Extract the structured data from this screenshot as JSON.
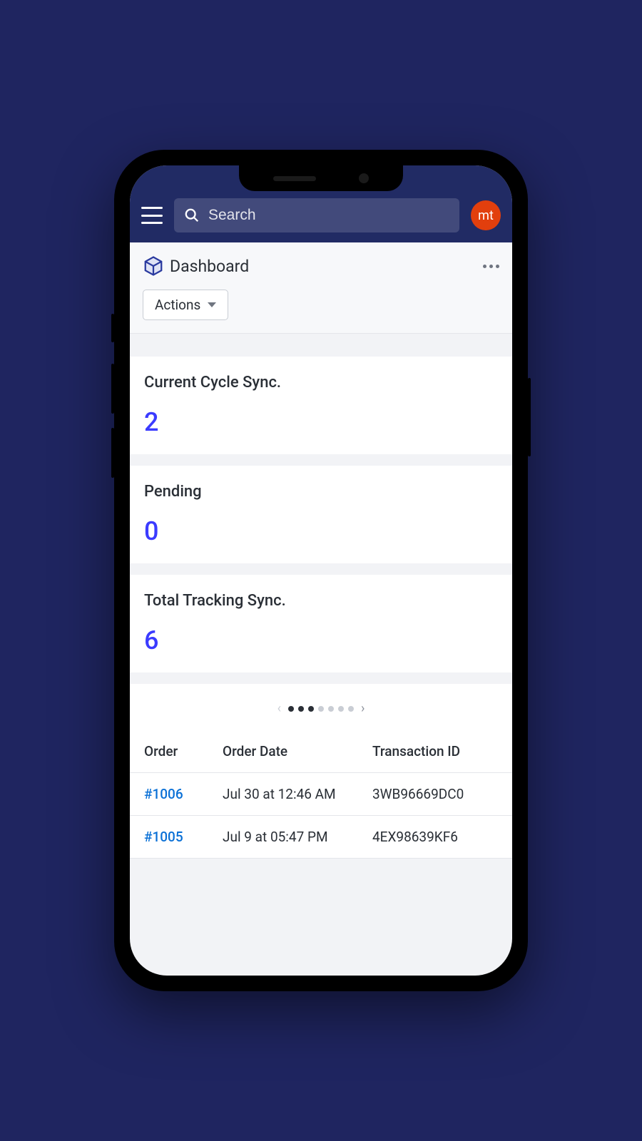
{
  "header": {
    "search_placeholder": "Search",
    "avatar_text": "mt"
  },
  "page": {
    "title": "Dashboard",
    "actions_label": "Actions"
  },
  "cards": [
    {
      "label": "Current Cycle Sync.",
      "value": "2"
    },
    {
      "label": "Pending",
      "value": "0"
    },
    {
      "label": "Total Tracking Sync.",
      "value": "6"
    }
  ],
  "pager": {
    "active_count": 3,
    "total": 7
  },
  "table": {
    "headers": {
      "order": "Order",
      "date": "Order Date",
      "txn": "Transaction ID"
    },
    "rows": [
      {
        "order": "#1006",
        "date": "Jul 30 at 12:46 AM",
        "txn": "3WB96669DC0"
      },
      {
        "order": "#1005",
        "date": "Jul 9 at 05:47 PM",
        "txn": "4EX98639KF6"
      }
    ]
  }
}
